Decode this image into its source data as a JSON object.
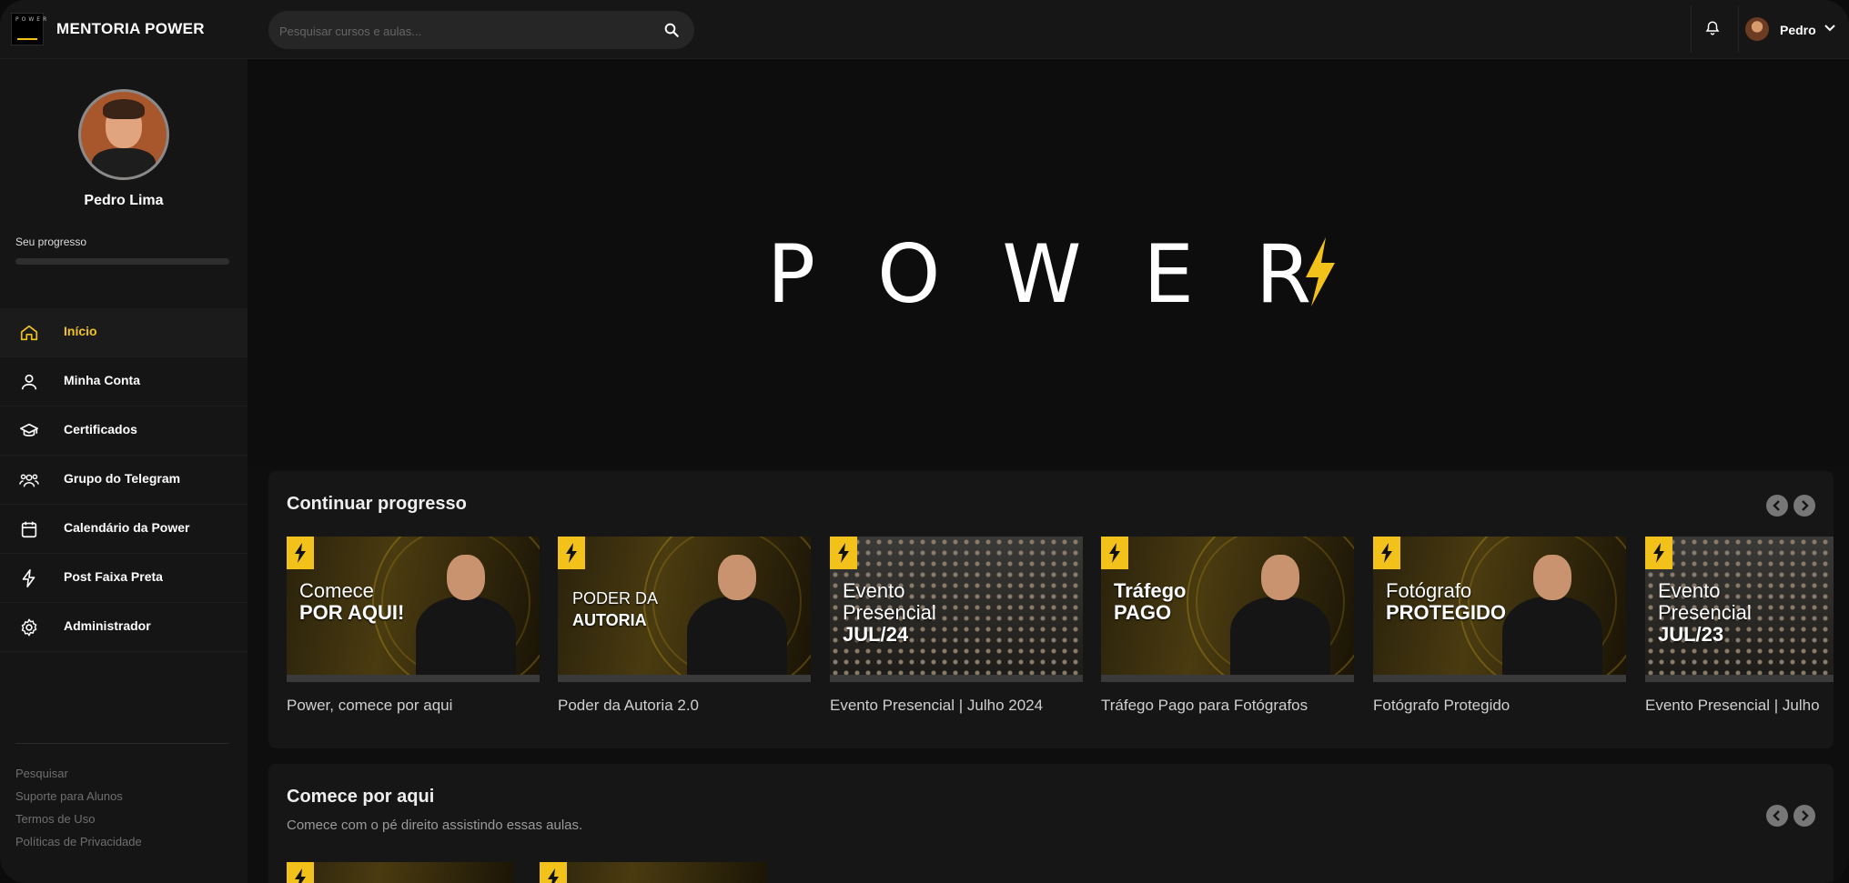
{
  "header": {
    "brand": "MENTORIA POWER",
    "logo_text": "POWER",
    "search_placeholder": "Pesquisar cursos e aulas...",
    "user_name": "Pedro"
  },
  "sidebar": {
    "user_name": "Pedro Lima",
    "progress_label": "Seu progresso",
    "progress_percent": 0,
    "items": [
      {
        "label": "Início",
        "icon": "home-icon",
        "active": true
      },
      {
        "label": "Minha Conta",
        "icon": "user-icon",
        "active": false
      },
      {
        "label": "Certificados",
        "icon": "graduation-cap-icon",
        "active": false
      },
      {
        "label": "Grupo do Telegram",
        "icon": "users-icon",
        "active": false
      },
      {
        "label": "Calendário da Power",
        "icon": "calendar-icon",
        "active": false
      },
      {
        "label": "Post Faixa Preta",
        "icon": "lightning-icon",
        "active": false
      },
      {
        "label": "Administrador",
        "icon": "gear-icon",
        "active": false
      }
    ],
    "footer_links": [
      "Pesquisar",
      "Suporte para Alunos",
      "Termos de Uso",
      "Políticas de Privacidade"
    ]
  },
  "hero": {
    "wordmark": "POWER"
  },
  "sections": [
    {
      "title": "Continuar progresso",
      "subtitle": "",
      "cards": [
        {
          "title": "Power, comece por aqui",
          "thumb_line1": "Comece",
          "thumb_line2": "POR AQUI!",
          "thumb_line3": ""
        },
        {
          "title": "Poder da Autoria 2.0",
          "thumb_line1": "PODER DA",
          "thumb_line2": "AUTORIA",
          "thumb_line3": ""
        },
        {
          "title": "Evento Presencial | Julho 2024",
          "thumb_line1": "Evento",
          "thumb_line2": "Presencial",
          "thumb_line3": "JUL/24"
        },
        {
          "title": "Tráfego Pago para Fotógrafos",
          "thumb_line1": "Tráfego",
          "thumb_line2": "PAGO",
          "thumb_line3": ""
        },
        {
          "title": "Fotógrafo Protegido",
          "thumb_line1": "Fotógrafo",
          "thumb_line2": "PROTEGIDO",
          "thumb_line3": ""
        },
        {
          "title": "Evento Presencial | Julho",
          "thumb_line1": "Evento",
          "thumb_line2": "Presencial",
          "thumb_line3": "JUL/23"
        }
      ]
    },
    {
      "title": "Comece por aqui",
      "subtitle": "Comece com o pé direito assistindo essas aulas."
    }
  ],
  "colors": {
    "accent": "#f2c21b",
    "background": "#0e0e0e",
    "panel": "#161616"
  }
}
